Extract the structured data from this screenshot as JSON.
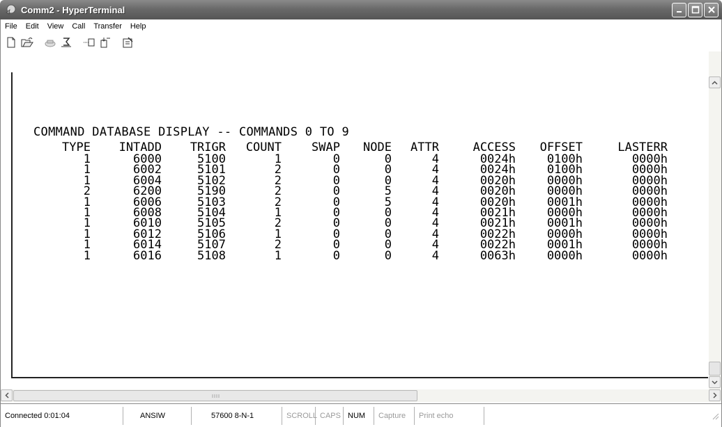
{
  "window": {
    "title": "Comm2 - HyperTerminal",
    "controls": [
      "minimize",
      "maximize",
      "close"
    ]
  },
  "menu": [
    "File",
    "Edit",
    "View",
    "Call",
    "Transfer",
    "Help"
  ],
  "toolbar": [
    {
      "icon": "new-icon"
    },
    {
      "icon": "open-icon"
    },
    {
      "icon": "connect-icon"
    },
    {
      "icon": "disconnect-icon"
    },
    {
      "icon": "send-icon"
    },
    {
      "icon": "receive-icon"
    },
    {
      "icon": "properties-icon"
    }
  ],
  "terminal": {
    "heading": "COMMAND DATABASE DISPLAY -- COMMANDS 0 TO 9",
    "columns": [
      "TYPE",
      "INTADD",
      "TRIGR",
      "COUNT",
      "SWAP",
      "NODE",
      "ATTR",
      "ACCESS",
      "OFFSET",
      "LASTERR"
    ],
    "rows": [
      [
        "1",
        "6000",
        "5100",
        "1",
        "0",
        "0",
        "4",
        "0024h",
        "0100h",
        "0000h"
      ],
      [
        "1",
        "6002",
        "5101",
        "2",
        "0",
        "0",
        "4",
        "0024h",
        "0100h",
        "0000h"
      ],
      [
        "1",
        "6004",
        "5102",
        "2",
        "0",
        "0",
        "4",
        "0020h",
        "0000h",
        "0000h"
      ],
      [
        "2",
        "6200",
        "5190",
        "2",
        "0",
        "5",
        "4",
        "0020h",
        "0000h",
        "0000h"
      ],
      [
        "1",
        "6006",
        "5103",
        "2",
        "0",
        "5",
        "4",
        "0020h",
        "0001h",
        "0000h"
      ],
      [
        "1",
        "6008",
        "5104",
        "1",
        "0",
        "0",
        "4",
        "0021h",
        "0000h",
        "0000h"
      ],
      [
        "1",
        "6010",
        "5105",
        "2",
        "0",
        "0",
        "4",
        "0021h",
        "0001h",
        "0000h"
      ],
      [
        "1",
        "6012",
        "5106",
        "1",
        "0",
        "0",
        "4",
        "0022h",
        "0000h",
        "0000h"
      ],
      [
        "1",
        "6014",
        "5107",
        "2",
        "0",
        "0",
        "4",
        "0022h",
        "0001h",
        "0000h"
      ],
      [
        "1",
        "6016",
        "5108",
        "1",
        "0",
        "0",
        "4",
        "0063h",
        "0000h",
        "0000h"
      ]
    ]
  },
  "status": {
    "connected": "Connected 0:01:04",
    "emulation": "ANSIW",
    "settings": "57600 8-N-1",
    "scroll": "SCROLL",
    "caps": "CAPS",
    "num": "NUM",
    "capture": "Capture",
    "print_echo": "Print echo"
  },
  "colors": {
    "titlebar": "#6a6a6a",
    "text": "#000000",
    "background": "#ffffff"
  }
}
